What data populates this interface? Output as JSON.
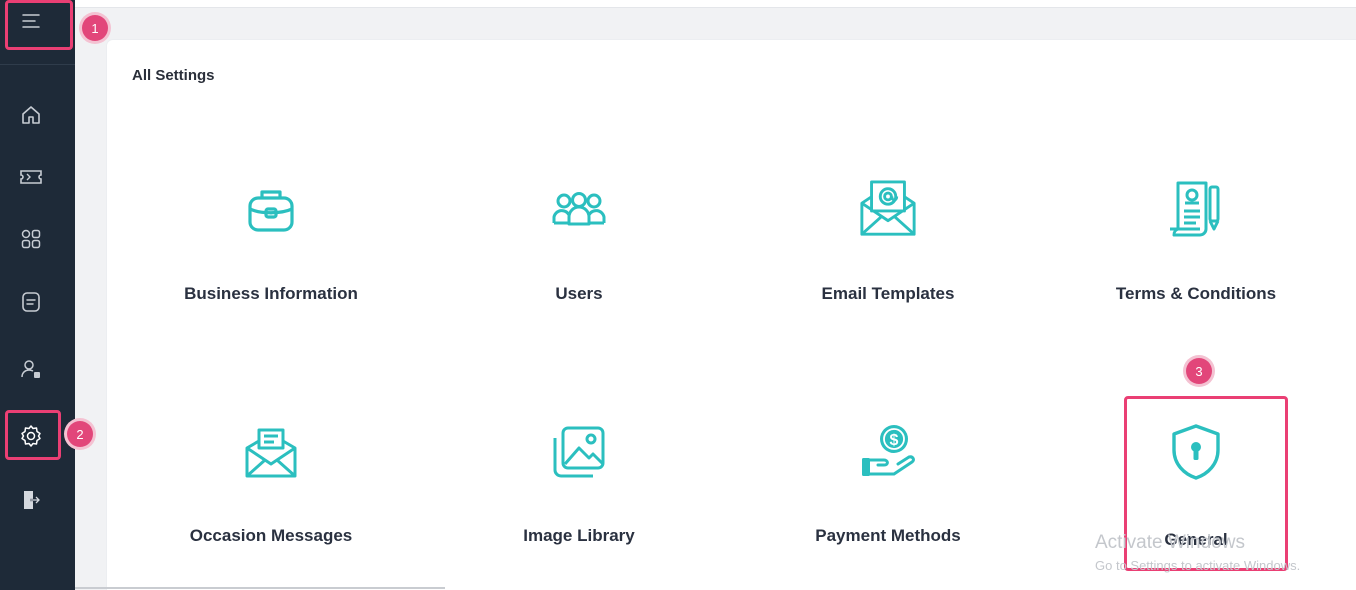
{
  "sidebar": {
    "items": [
      {
        "icon": "hamburger-menu-icon"
      },
      {
        "icon": "home-icon"
      },
      {
        "icon": "ticket-icon"
      },
      {
        "icon": "apps-grid-icon"
      },
      {
        "icon": "document-icon"
      },
      {
        "icon": "user-manage-icon"
      },
      {
        "icon": "settings-gear-icon"
      },
      {
        "icon": "logout-icon"
      }
    ]
  },
  "main": {
    "title": "All Settings",
    "tiles": [
      {
        "label": "Business Information",
        "icon": "briefcase-icon"
      },
      {
        "label": "Users",
        "icon": "users-group-icon"
      },
      {
        "label": "Email Templates",
        "icon": "email-template-icon"
      },
      {
        "label": "Terms & Conditions",
        "icon": "terms-document-icon"
      },
      {
        "label": "Occasion Messages",
        "icon": "occasion-message-icon"
      },
      {
        "label": "Image Library",
        "icon": "image-library-icon"
      },
      {
        "label": "Payment Methods",
        "icon": "payment-hand-icon"
      },
      {
        "label": "General",
        "icon": "shield-lock-icon"
      }
    ]
  },
  "annotations": {
    "badges": [
      "1",
      "2",
      "3"
    ],
    "highlight_color": "#ea3f74"
  },
  "watermark": {
    "line1": "Activate Windows",
    "line2": "Go to Settings to activate Windows."
  },
  "colors": {
    "accent": "#2bbfbf",
    "sidebar_bg": "#1e2a38"
  }
}
